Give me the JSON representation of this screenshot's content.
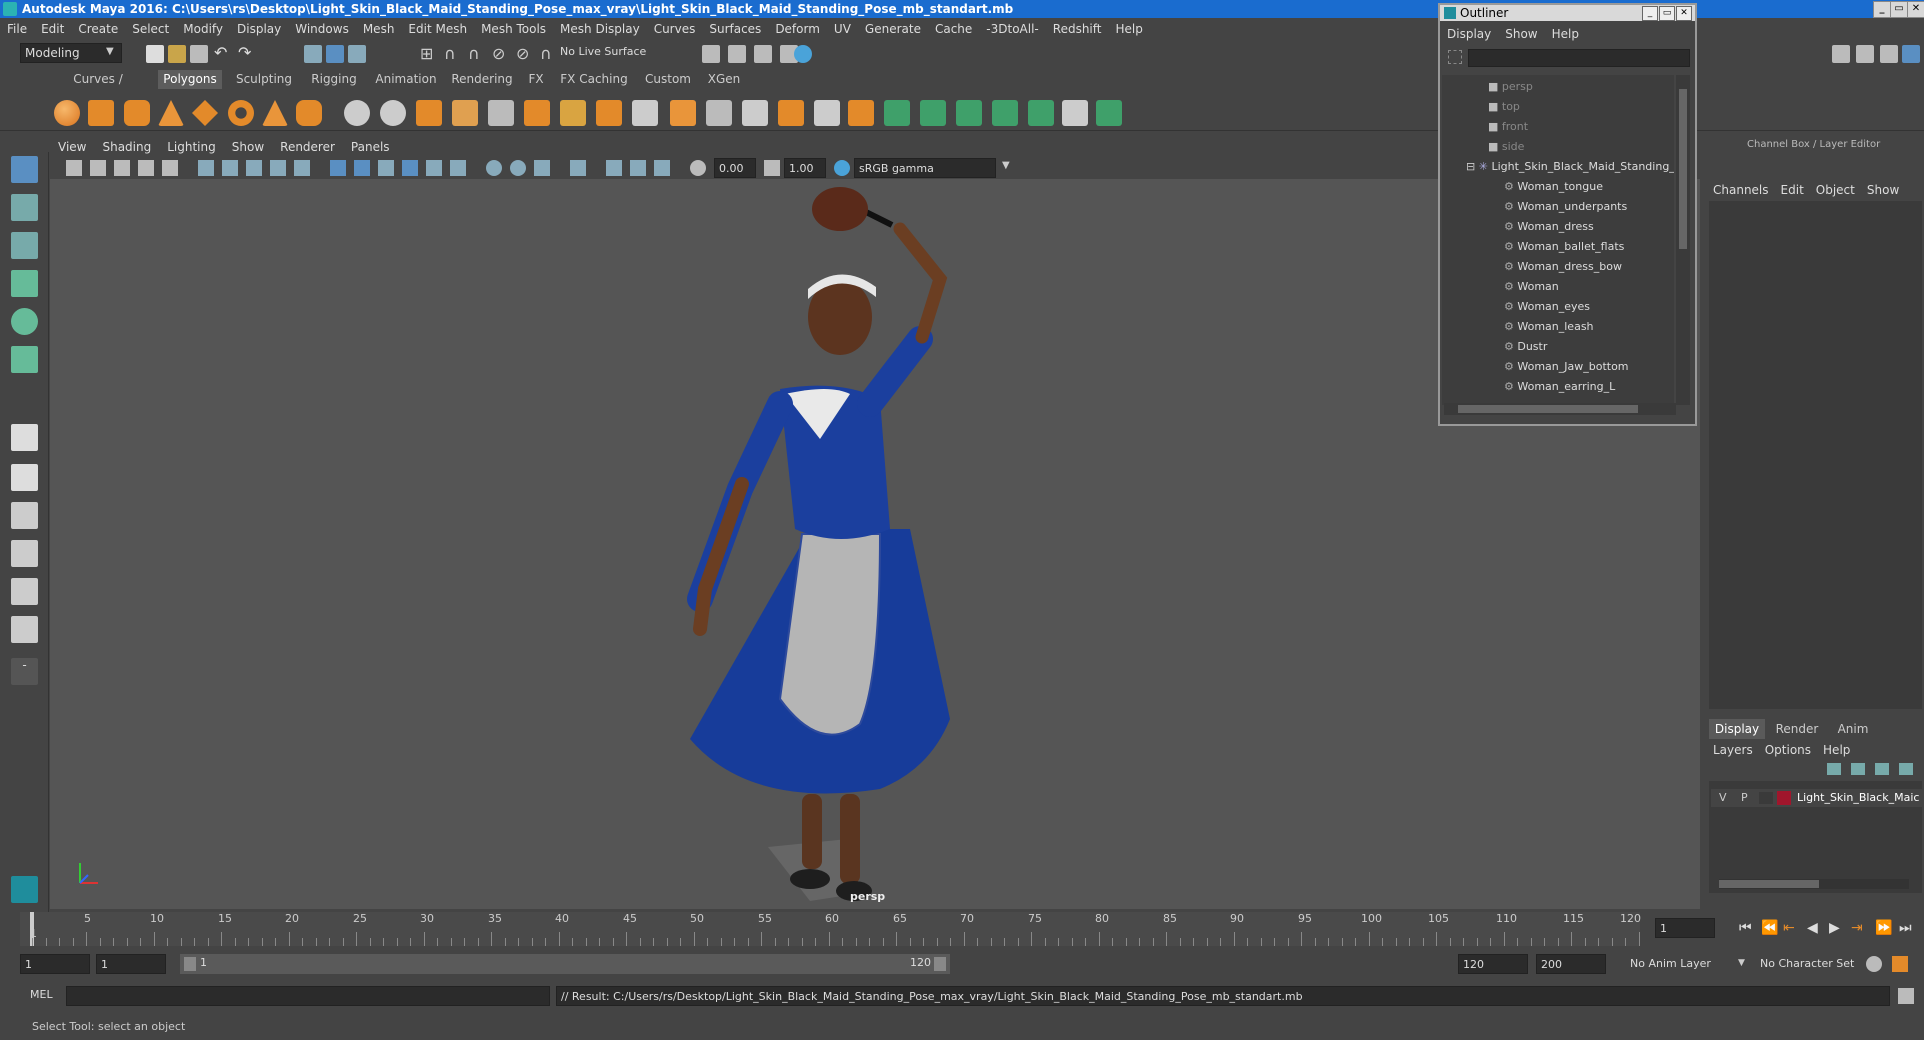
{
  "titlebar": {
    "title": "Autodesk Maya 2016: C:\\Users\\rs\\Desktop\\Light_Skin_Black_Maid_Standing_Pose_max_vray\\Light_Skin_Black_Maid_Standing_Pose_mb_standart.mb",
    "min": "_",
    "max": "▭",
    "close": "✕"
  },
  "menubar": [
    "File",
    "Edit",
    "Create",
    "Select",
    "Modify",
    "Display",
    "Windows",
    "Mesh",
    "Edit Mesh",
    "Mesh Tools",
    "Mesh Display",
    "Curves",
    "Surfaces",
    "Deform",
    "UV",
    "Generate",
    "Cache",
    "-3DtoAll-",
    "Redshift",
    "Help"
  ],
  "toolbar": {
    "mode": "Modeling",
    "live_surface": "No Live Surface"
  },
  "shelf_tabs": [
    "Curves / Surfaces",
    "Polygons",
    "Sculpting",
    "Rigging",
    "Animation",
    "Rendering",
    "FX",
    "FX Caching",
    "Custom",
    "XGen"
  ],
  "shelf_active": "Polygons",
  "viewport": {
    "menu": [
      "View",
      "Shading",
      "Lighting",
      "Show",
      "Renderer",
      "Panels"
    ],
    "exposure": "0.00",
    "gamma": "1.00",
    "colorspace": "sRGB gamma",
    "camera_label": "persp"
  },
  "outliner": {
    "title": "Outliner",
    "menu": [
      "Display",
      "Show",
      "Help"
    ],
    "cameras": [
      "persp",
      "top",
      "front",
      "side"
    ],
    "root": "Light_Skin_Black_Maid_Standing_",
    "children": [
      "Woman_tongue",
      "Woman_underpants",
      "Woman_dress",
      "Woman_ballet_flats",
      "Woman_dress_bow",
      "Woman",
      "Woman_eyes",
      "Woman_leash",
      "Dustr",
      "Woman_Jaw_bottom",
      "Woman_earring_L"
    ]
  },
  "channel_box": {
    "title": "Channel Box / Layer Editor",
    "menu": [
      "Channels",
      "Edit",
      "Object",
      "Show"
    ],
    "tabs": [
      "Display",
      "Render",
      "Anim"
    ],
    "active_tab": "Display",
    "layer_menu": [
      "Layers",
      "Options",
      "Help"
    ],
    "layer": {
      "v": "V",
      "p": "P",
      "name": "Light_Skin_Black_Maic",
      "color": "#a0162c"
    }
  },
  "timeline": {
    "labels": [
      "1",
      "5",
      "10",
      "15",
      "20",
      "25",
      "30",
      "35",
      "40",
      "45",
      "50",
      "55",
      "60",
      "65",
      "70",
      "75",
      "80",
      "85",
      "90",
      "95",
      "100",
      "105",
      "110",
      "115",
      "120"
    ],
    "current_frame": "1"
  },
  "range": {
    "start": "1",
    "start2": "1",
    "slider_start": "1",
    "slider_end": "120",
    "end": "120",
    "end2": "200",
    "anim_layer": "No Anim Layer",
    "char_set": "No Character Set"
  },
  "command": {
    "lang": "MEL",
    "result": "// Result: C:/Users/rs/Desktop/Light_Skin_Black_Maid_Standing_Pose_max_vray/Light_Skin_Black_Maid_Standing_Pose_mb_standart.mb"
  },
  "help_line": "Select Tool: select an object"
}
